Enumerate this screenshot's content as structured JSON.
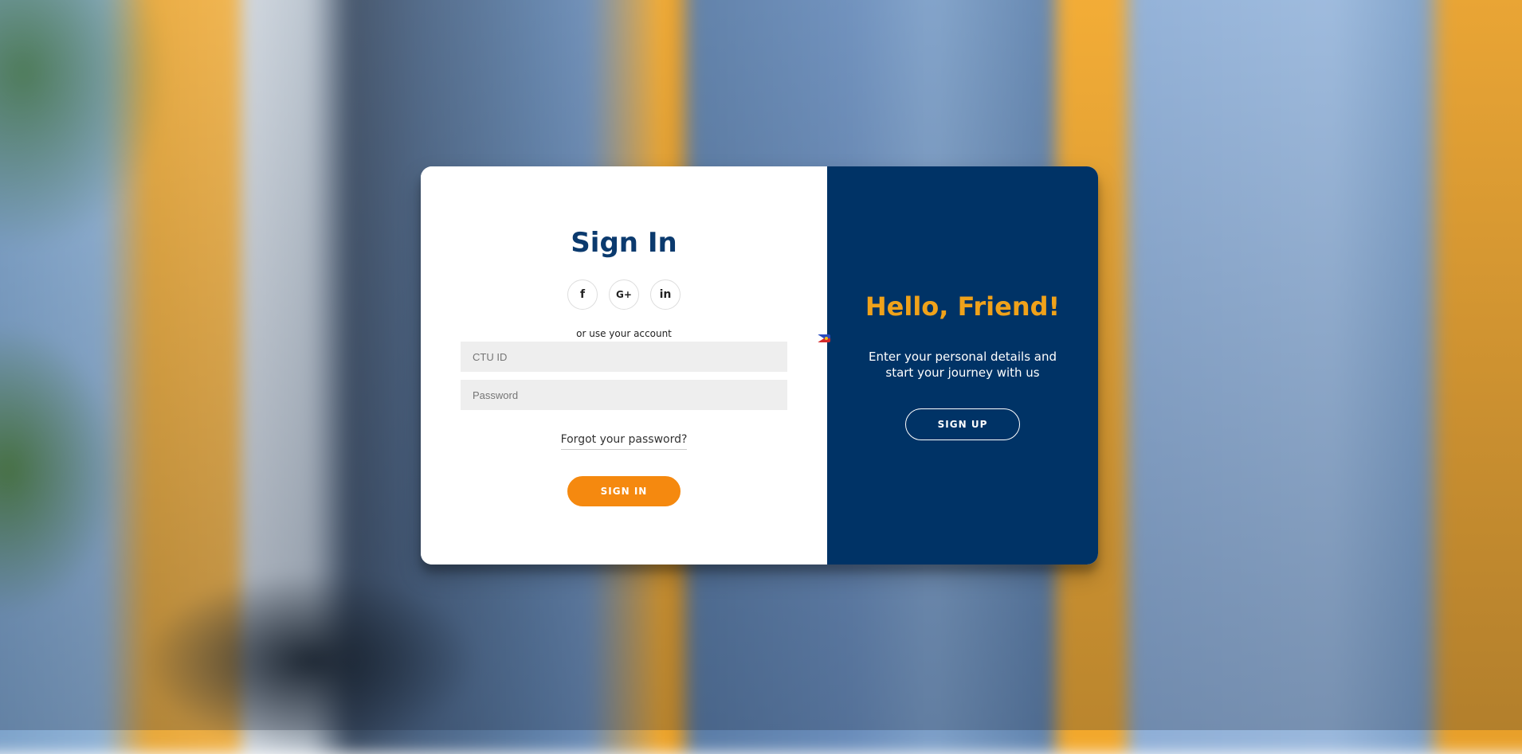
{
  "signin": {
    "title": "Sign In",
    "social": [
      {
        "icon": "facebook-icon",
        "glyph": "f"
      },
      {
        "icon": "google-plus-icon",
        "glyph": "G+"
      },
      {
        "icon": "linkedin-icon",
        "glyph": "in"
      }
    ],
    "use_account": "or use your account",
    "id_placeholder": "CTU ID",
    "password_placeholder": "Password",
    "forgot": "Forgot your password?",
    "button": "Sign In"
  },
  "overlay": {
    "title": "Hello, Friend!",
    "text": "Enter your personal details and start your journey with us",
    "button": "Sign Up"
  },
  "colors": {
    "brand_navy": "#003366",
    "accent_orange": "#f5890f",
    "title_orange": "#f0a21a",
    "title_navy": "#0b3a6e"
  },
  "icons": {
    "language_flag": "philippines-flag-icon"
  }
}
